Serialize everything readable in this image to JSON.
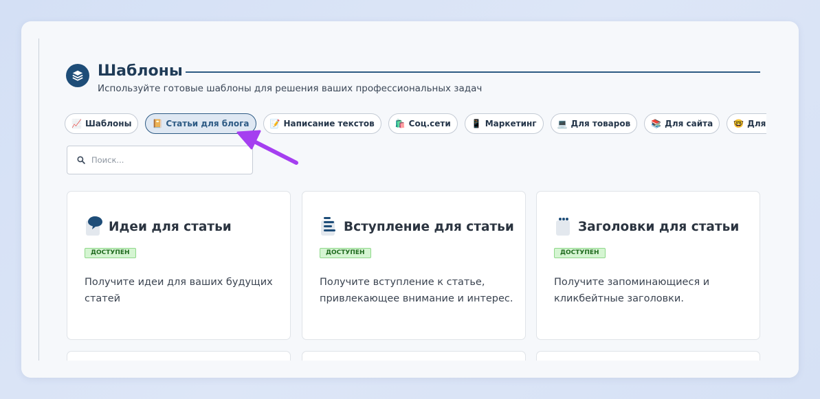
{
  "header": {
    "title": "Шаблоны",
    "subtitle": "Используйте готовые шаблоны для решения ваших профессиональных задач"
  },
  "chips": [
    {
      "icon": "chart-icon",
      "glyph": "📈",
      "label": "Шаблоны",
      "active": false
    },
    {
      "icon": "notebook-icon",
      "glyph": "📔",
      "label": "Статьи для блога",
      "active": true
    },
    {
      "icon": "memo-icon",
      "glyph": "📝",
      "label": "Написание текстов",
      "active": false
    },
    {
      "icon": "shopping-bags-icon",
      "glyph": "🛍️",
      "label": "Соц.сети",
      "active": false
    },
    {
      "icon": "mobile-phone-icon",
      "glyph": "📱",
      "label": "Маркетинг",
      "active": false
    },
    {
      "icon": "laptop-icon",
      "glyph": "💻",
      "label": "Для товаров",
      "active": false
    },
    {
      "icon": "books-icon",
      "glyph": "📚",
      "label": "Для сайта",
      "active": false
    },
    {
      "icon": "nerd-face-icon",
      "glyph": "🤓",
      "label": "Для школы",
      "active": false
    },
    {
      "icon": "more-icon",
      "glyph": "",
      "label": "Д",
      "active": false
    }
  ],
  "search": {
    "placeholder": "Поиск..."
  },
  "cards": [
    {
      "title": "Идеи для статьи",
      "badge": "ДОСТУПЕН",
      "description": "Получите идеи для ваших будущих статей"
    },
    {
      "title": "Вступление для статьи",
      "badge": "ДОСТУПЕН",
      "description": "Получите вступление к статье, привлекающее внимание и интерес."
    },
    {
      "title": "Заголовки для статьи",
      "badge": "ДОСТУПЕН",
      "description": "Получите запоминающиеся и кликбейтные заголовки."
    }
  ],
  "colors": {
    "accent": "#1e4d78",
    "annotation_arrow": "#a53ff0",
    "badge_bg": "#d5f5d2"
  }
}
